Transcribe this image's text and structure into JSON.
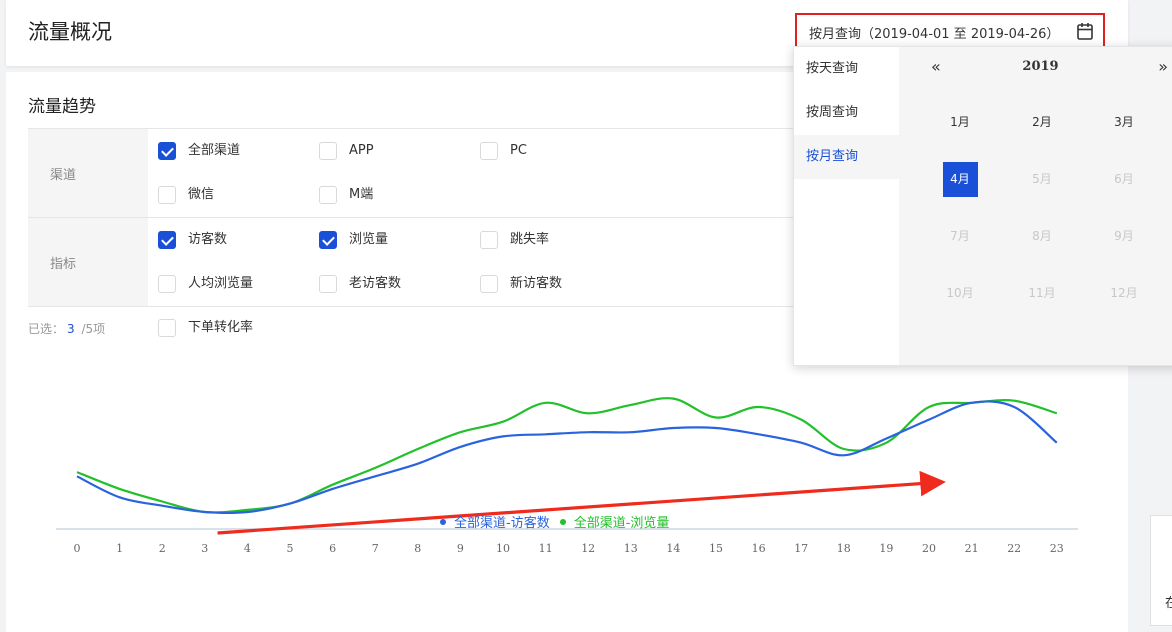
{
  "header": {
    "title": "流量概况"
  },
  "date_picker": {
    "value": "按月查询（2019-04-01 至 2019-04-26）",
    "modes": [
      {
        "label": "按天查询",
        "active": false
      },
      {
        "label": "按周查询",
        "active": false
      },
      {
        "label": "按月查询",
        "active": true
      }
    ],
    "year": "2019",
    "prev_symbol": "«",
    "next_symbol": "»",
    "months": [
      {
        "label": "1月",
        "state": "normal"
      },
      {
        "label": "2月",
        "state": "normal"
      },
      {
        "label": "3月",
        "state": "normal"
      },
      {
        "label": "4月",
        "state": "selected"
      },
      {
        "label": "5月",
        "state": "disabled"
      },
      {
        "label": "6月",
        "state": "disabled"
      },
      {
        "label": "7月",
        "state": "disabled"
      },
      {
        "label": "8月",
        "state": "disabled"
      },
      {
        "label": "9月",
        "state": "disabled"
      },
      {
        "label": "10月",
        "state": "disabled"
      },
      {
        "label": "11月",
        "state": "disabled"
      },
      {
        "label": "12月",
        "state": "disabled"
      }
    ]
  },
  "trend": {
    "title": "流量趋势",
    "channel_label": "渠道",
    "channels": [
      {
        "label": "全部渠道",
        "checked": true
      },
      {
        "label": "APP",
        "checked": false
      },
      {
        "label": "PC",
        "checked": false
      },
      {
        "label": "微信",
        "checked": false
      },
      {
        "label": "M端",
        "checked": false
      }
    ],
    "metric_label": "指标",
    "metrics": [
      {
        "label": "访客数",
        "checked": true
      },
      {
        "label": "浏览量",
        "checked": true
      },
      {
        "label": "跳失率",
        "checked": false
      },
      {
        "label": "人均浏览量",
        "checked": false
      },
      {
        "label": "老访客数",
        "checked": false
      },
      {
        "label": "新访客数",
        "checked": false
      },
      {
        "label": "下单转化率",
        "checked": false
      }
    ],
    "selected_prefix": "已选：",
    "selected_count": "3",
    "selected_suffix": " /5项"
  },
  "colors": {
    "accent": "#1a4fd8",
    "visitors": "#2a63de",
    "pageviews": "#22c02a",
    "arrow": "#ee2b1c"
  },
  "chart_data": {
    "type": "line",
    "x": [
      "0",
      "1",
      "2",
      "3",
      "4",
      "5",
      "6",
      "7",
      "8",
      "9",
      "10",
      "11",
      "12",
      "13",
      "14",
      "15",
      "16",
      "17",
      "18",
      "19",
      "20",
      "21",
      "22",
      "23"
    ],
    "ylim": [
      0,
      100
    ],
    "series": [
      {
        "name": "全部渠道-访客数",
        "color": "#2a63de",
        "values": [
          17,
          7,
          3,
          0,
          0,
          4,
          11,
          17,
          23,
          31,
          36,
          37,
          38,
          38,
          40,
          40,
          37,
          33,
          27,
          35,
          44,
          52,
          50,
          33
        ]
      },
      {
        "name": "全部渠道-浏览量",
        "color": "#22c02a",
        "values": [
          19,
          11,
          5,
          0,
          1,
          4,
          13,
          21,
          30,
          38,
          43,
          52,
          47,
          51,
          54,
          45,
          50,
          44,
          30,
          33,
          50,
          52,
          53,
          47
        ]
      }
    ],
    "annotation": {
      "type": "arrow",
      "from": [
        3.3,
        -10
      ],
      "to": [
        20.5,
        15
      ]
    }
  },
  "right_edge": {
    "text": "在"
  }
}
